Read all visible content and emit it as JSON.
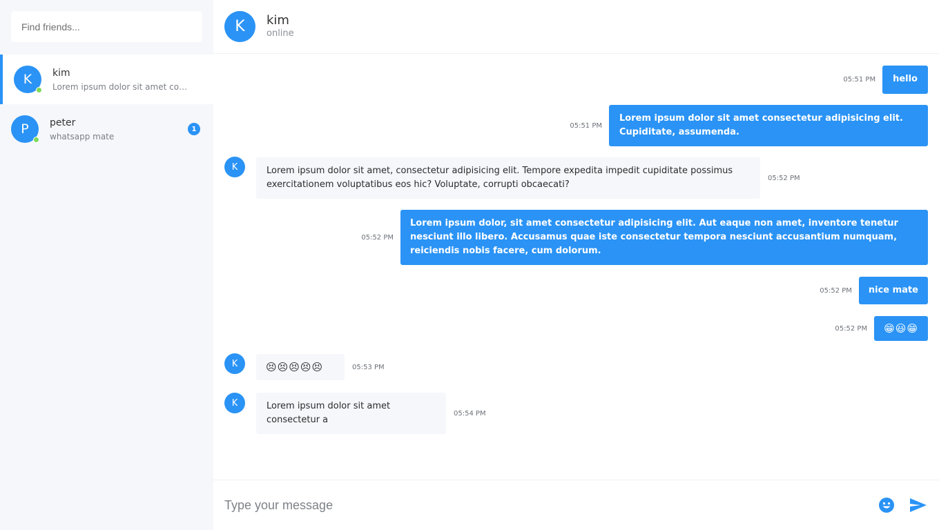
{
  "colors": {
    "accent": "#2a93f5",
    "online": "#7ed957",
    "sidebar_bg": "#f5f7fb"
  },
  "search": {
    "placeholder": "Find friends..."
  },
  "contacts": [
    {
      "initial": "K",
      "name": "kim",
      "preview": "Lorem ipsum dolor sit amet con...",
      "online": true,
      "active": true
    },
    {
      "initial": "P",
      "name": "peter",
      "preview": "whatsapp mate",
      "online": true,
      "unread": "1"
    }
  ],
  "chat_header": {
    "initial": "K",
    "name": "kim",
    "status": "online"
  },
  "messages": [
    {
      "from": "me",
      "text": "hello",
      "time": "05:51 PM"
    },
    {
      "from": "me",
      "text": "Lorem ipsum dolor sit amet consectetur adipisicing elit. Cupiditate, assumenda.",
      "time": "05:51 PM"
    },
    {
      "from": "kim",
      "avatar": "K",
      "text": "Lorem ipsum dolor sit amet, consectetur adipisicing elit. Tempore expedita impedit cupiditate possimus exercitationem voluptatibus eos hic? Voluptate, corrupti obcaecati?",
      "time": "05:52 PM"
    },
    {
      "from": "me",
      "text": "Lorem ipsum dolor, sit amet consectetur adipisicing elit. Aut eaque non amet, inventore tenetur nesciunt illo libero. Accusamus quae iste consectetur tempora nesciunt accusantium numquam, reiciendis nobis facere, cum dolorum.",
      "time": "05:52 PM"
    },
    {
      "from": "me",
      "text": "nice mate",
      "time": "05:52 PM"
    },
    {
      "from": "me",
      "text": "😁😃😁",
      "time": "05:52 PM"
    },
    {
      "from": "kim",
      "avatar": "K",
      "text": "😣😣😣😣😣",
      "time": "05:53 PM"
    },
    {
      "from": "kim",
      "avatar": "K",
      "text": "Lorem ipsum dolor sit amet consectetur a",
      "time": "05:54 PM"
    }
  ],
  "composer": {
    "placeholder": "Type your message"
  },
  "icons": {
    "emoji": "smiley-face-icon",
    "send": "send-arrow-icon"
  }
}
